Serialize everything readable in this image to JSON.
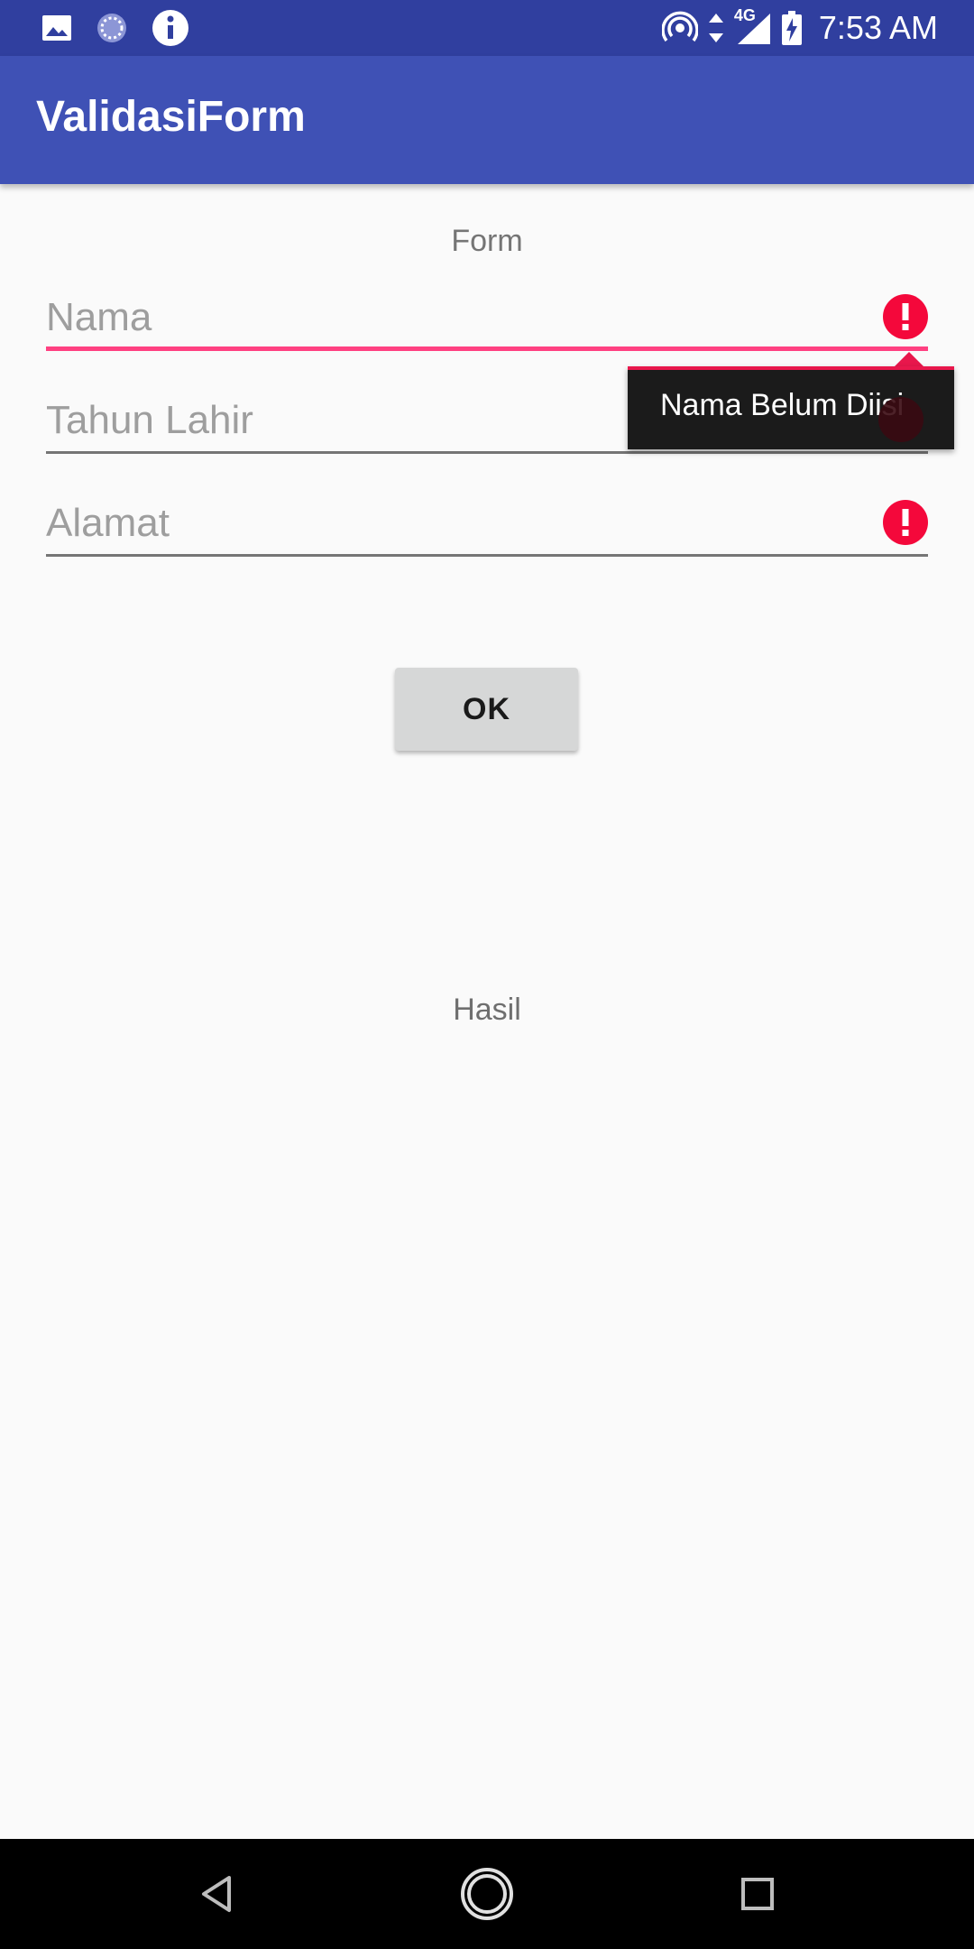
{
  "status_bar": {
    "time": "7:53 AM",
    "network": "4G",
    "icons_left": [
      "image-icon",
      "loading-icon",
      "info-icon"
    ],
    "icons_right": [
      "hotspot-icon",
      "data-arrows-icon",
      "signal-icon",
      "battery-charging-icon"
    ]
  },
  "app_bar": {
    "title": "ValidasiForm",
    "color": "#3f51b5",
    "status_color": "#303f9f"
  },
  "form": {
    "heading": "Form",
    "fields": [
      {
        "placeholder": "Nama",
        "value": "",
        "error": true,
        "focused": true
      },
      {
        "placeholder": "Tahun Lahir",
        "value": "",
        "error": true,
        "focused": false
      },
      {
        "placeholder": "Alamat",
        "value": "",
        "error": true,
        "focused": false
      }
    ],
    "error_tooltip": "Nama Belum Diisi",
    "error_color": "#f4083b",
    "accent_color": "#ff4081"
  },
  "ok_button": {
    "label": "OK"
  },
  "result": {
    "label": "Hasil"
  },
  "nav_bar": {
    "buttons": [
      "back-icon",
      "home-icon",
      "recents-icon"
    ]
  }
}
